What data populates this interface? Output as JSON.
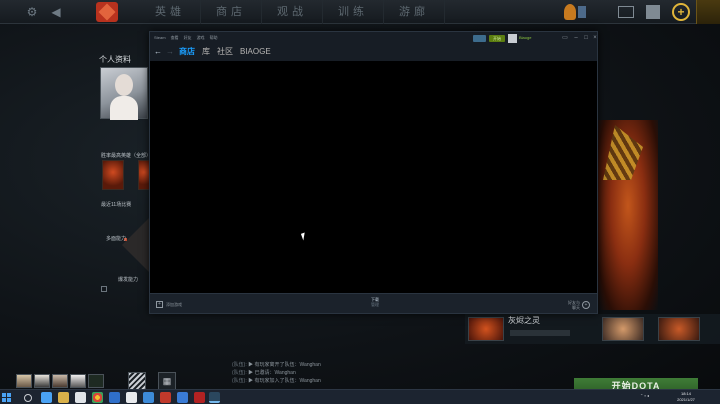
{
  "dota": {
    "nav": [
      "英雄",
      "商店",
      "观战",
      "训练",
      "游廊"
    ],
    "profile_title": "个人资料",
    "stats_header": "胜率最高英雄（全部）",
    "recent_matches": "最近11场比赛",
    "radar_labels": [
      "多面能力",
      "爆发能力"
    ],
    "featured_hero": "灰烬之灵",
    "play_button": "开始DOTA",
    "chat": [
      {
        "tag": "(队伍):",
        "text": "▶ 有玩家离开了队伍：Wanghan"
      },
      {
        "tag": "(队伍):",
        "text": "▶ 已邀请：Wanghan"
      },
      {
        "tag": "(队伍):",
        "text": "▶ 有玩家加入了队伍：Wanghan"
      }
    ]
  },
  "steam": {
    "menu": [
      "Steam",
      "查看",
      "好友",
      "游戏",
      "帮助"
    ],
    "play_label": "开始",
    "username": "Biaoge",
    "tabs": {
      "store": "商店",
      "library": "库",
      "community": "社区",
      "user": "BIAOGE"
    },
    "add_game": "添加游戏",
    "downloads": "下载",
    "downloads_sub": "管理",
    "friends": "好友与聊天"
  },
  "taskbar": {
    "time": "18:14",
    "date": "2021/1/27"
  },
  "colors": {
    "steam_active_tab": "#1a9fff",
    "play_button": "#3f7c37",
    "dota_logo": "#b8321e"
  }
}
